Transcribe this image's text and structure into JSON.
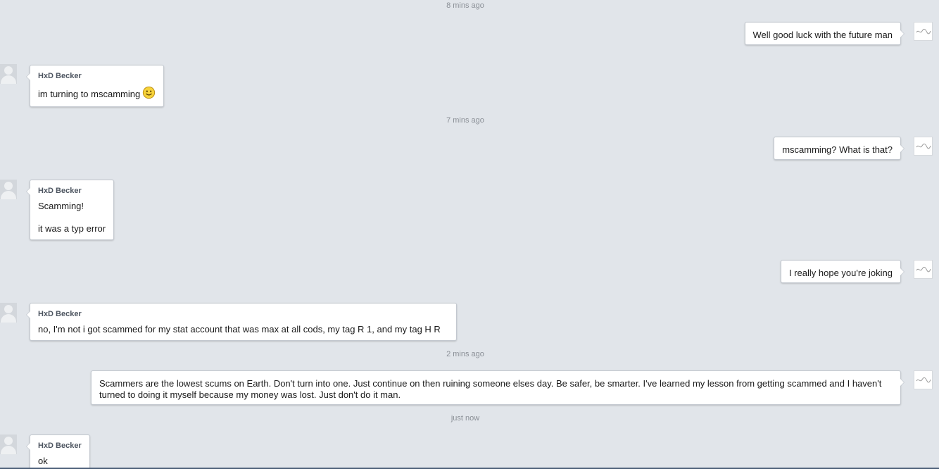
{
  "contact": {
    "name": "HxD Becker"
  },
  "timestamps": [
    "8 mins ago",
    "7 mins ago",
    "2 mins ago",
    "just now"
  ],
  "messages": [
    {
      "from": "me",
      "lines": [
        "Well good luck with the future man"
      ]
    },
    {
      "from": "contact",
      "lines": [
        "im turning to mscamming"
      ],
      "emoticon": "smiley-icon"
    },
    {
      "from": "me",
      "lines": [
        "mscamming? What is that?"
      ]
    },
    {
      "from": "contact",
      "lines": [
        "Scamming!",
        "it was a typ error"
      ]
    },
    {
      "from": "me",
      "lines": [
        "I really hope you're joking"
      ]
    },
    {
      "from": "contact",
      "lines": [
        "no, I'm not i got scammed for my stat account that was max at all cods, my tag R 1, and my tag H R"
      ]
    },
    {
      "from": "me",
      "lines": [
        "Scammers are the lowest scums on Earth. Don't turn into one. Just continue on then ruining someone elses day. Be safer, be smarter. I've learned my lesson from getting scammed and I haven't turned to doing it myself because my money was lost. Just don't do it man."
      ]
    },
    {
      "from": "contact",
      "lines": [
        "ok"
      ]
    }
  ],
  "colors": {
    "background": "#e1e5ea",
    "bubble": "#ffffff",
    "bubble_border": "#c3c8cf",
    "timestamp_text": "#8a8f96",
    "sender_text": "#4d5560",
    "bottom_bar": "#4d6079"
  }
}
